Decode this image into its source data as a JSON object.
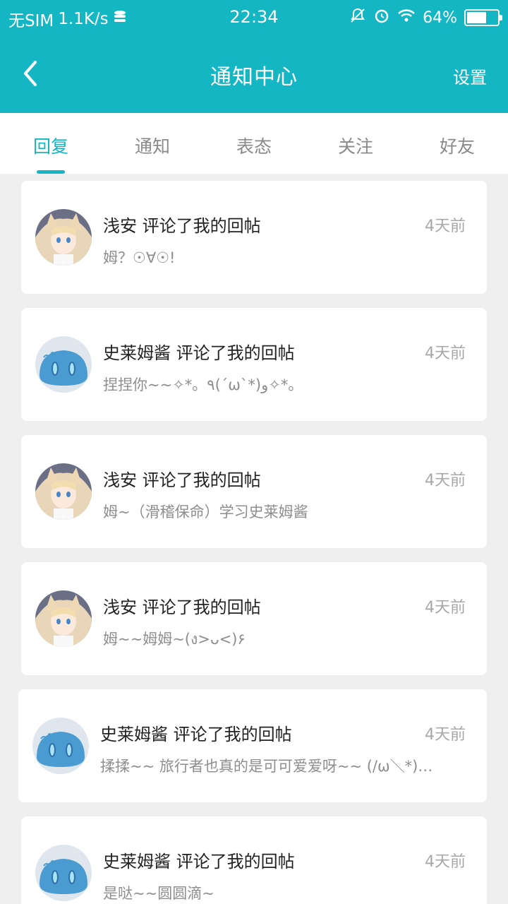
{
  "status_bar": {
    "carrier": "无SIM",
    "speed": "1.1K/s",
    "time": "22:34",
    "battery_text": "64%",
    "battery_level": 0.64,
    "icons": [
      "data-saver-icon",
      "mute-icon",
      "alarm-icon",
      "wifi-icon",
      "battery-icon"
    ]
  },
  "appbar": {
    "title": "通知中心",
    "settings_label": "设置",
    "back_icon": "chevron-left-icon"
  },
  "tabs": [
    {
      "label": "回复",
      "active": true
    },
    {
      "label": "通知",
      "active": false
    },
    {
      "label": "表态",
      "active": false
    },
    {
      "label": "关注",
      "active": false
    },
    {
      "label": "好友",
      "active": false
    }
  ],
  "notifications": [
    {
      "title": "浅安 评论了我的回帖",
      "time": "4天前",
      "message": "姆？☉∀☉!",
      "avatar": "anime-girl-avatar"
    },
    {
      "title": "史莱姆酱 评论了我的回帖",
      "time": "4天前",
      "message": "捏捏你~~✧*。٩(ˊωˋ*)و✧*。",
      "avatar": "slime-avatar"
    },
    {
      "title": "浅安 评论了我的回帖",
      "time": "4天前",
      "message": "姆~（滑稽保命）学习史莱姆酱",
      "avatar": "anime-girl-avatar"
    },
    {
      "title": "浅安 评论了我的回帖",
      "time": "4天前",
      "message": "姆~~姆姆~(ง>ᴗ<)۶",
      "avatar": "anime-girl-avatar"
    },
    {
      "title": "史莱姆酱 评论了我的回帖",
      "time": "4天前",
      "message": "揉揉~~ 旅行者也真的是可可爱爱呀~~ (/ω＼*)…",
      "avatar": "slime-avatar"
    },
    {
      "title": "史莱姆酱 评论了我的回帖",
      "time": "4天前",
      "message": "是哒~~圆圆滴~",
      "avatar": "slime-avatar"
    }
  ],
  "colors": {
    "accent": "#14b6c4",
    "background": "#efefef",
    "card": "#ffffff",
    "title_text": "#222222",
    "muted_text": "#8e8e8e"
  }
}
